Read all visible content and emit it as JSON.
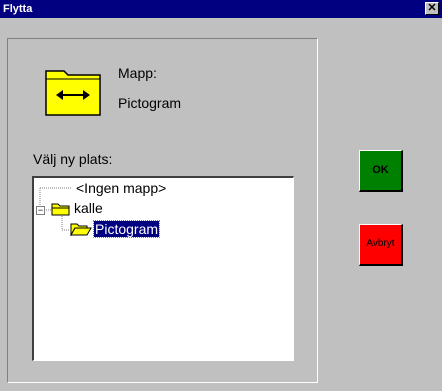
{
  "window": {
    "title": "Flytta",
    "close_glyph": "✕"
  },
  "current": {
    "label": "Mapp:",
    "folder_name": "Pictogram",
    "icon": "folder-move-icon",
    "icon_color": "#ffff00"
  },
  "location": {
    "label": "Välj ny plats:"
  },
  "tree": {
    "items": [
      {
        "label": "<Ingen mapp>",
        "level": 0,
        "expander": "",
        "icon": ""
      },
      {
        "label": "kalle",
        "level": 0,
        "expander": "−",
        "icon": "folder-icon"
      },
      {
        "label": "Pictogram",
        "level": 1,
        "expander": "",
        "icon": "open-folder-icon",
        "selected": true
      }
    ]
  },
  "buttons": {
    "ok": {
      "label": "OK",
      "color": "#008000"
    },
    "cancel": {
      "label": "Avbryt",
      "color": "#ff0000"
    }
  }
}
